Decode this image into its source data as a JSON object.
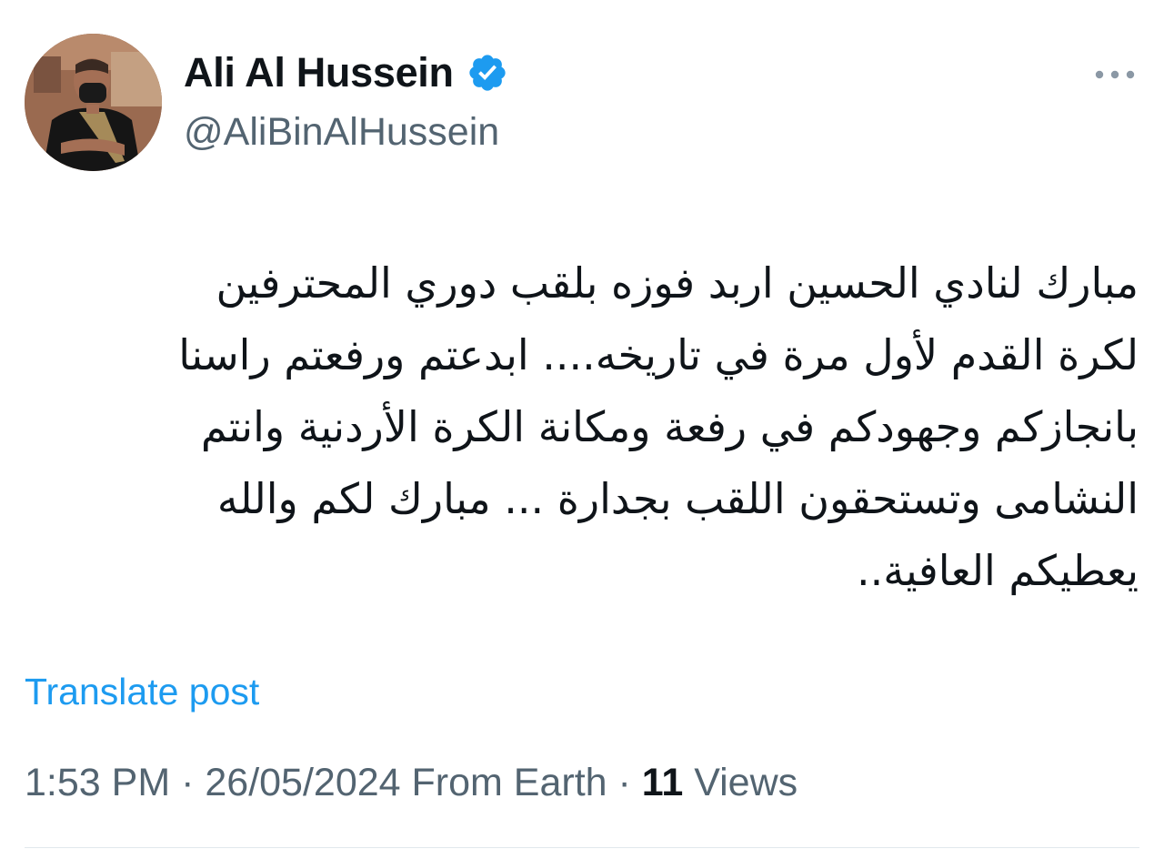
{
  "author": {
    "display_name": "Ali Al Hussein",
    "handle": "@AliBinAlHussein",
    "verified": true,
    "verified_icon": "verified-badge-icon",
    "avatar_icon": "avatar"
  },
  "more_icon": "more-dots-icon",
  "post": {
    "text": "مبارك لنادي الحسين اربد فوزه بلقب دوري المحترفين\nلكرة القدم لأول مرة في تاريخه....  ابدعتم ورفعتم راسنا\nبانجازكم وجهودكم في رفعة ومكانة الكرة الأردنية وانتم\nالنشامى وتستحقون اللقب بجدارة ... مبارك لكم والله\nيعطيكم العافية..",
    "translate_label": "Translate post"
  },
  "meta": {
    "time": "1:53 PM",
    "separator": " · ",
    "date": "26/05/2024",
    "source": "From Earth",
    "views_count": "11",
    "views_label": "Views"
  },
  "colors": {
    "text": "#0f1419",
    "secondary": "#536471",
    "accent": "#1d9bf0",
    "divider": "#e1e8ed"
  }
}
